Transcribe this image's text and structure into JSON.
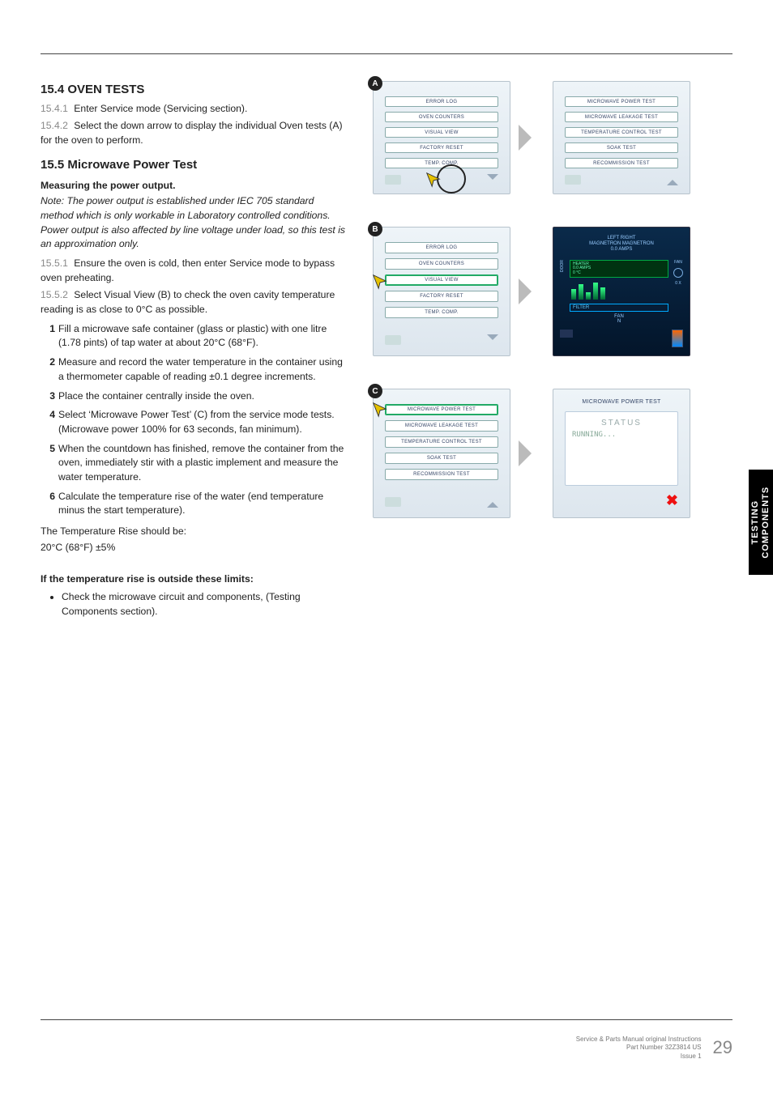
{
  "sidetab": "TESTING\nCOMPONENTS",
  "footer": {
    "line1": "Service & Parts Manual original Instructions",
    "line2": "Part Number 32Z3814 US",
    "line3": "Issue 1",
    "page": "29"
  },
  "s154": {
    "heading_num": "15.4",
    "heading": "OVEN TESTS",
    "p1_num": "15.4.1",
    "p1": "Enter Service mode (Servicing section).",
    "p2_num": "15.4.2",
    "p2": "Select the down arrow to display the individual Oven tests (A) for the oven to perform."
  },
  "s155": {
    "heading_num": "15.5",
    "heading": "Microwave Power Test",
    "sub_bold": "Measuring the power output.",
    "note": "Note: The power output is established under IEC 705 standard method which is only workable in Laboratory controlled conditions. Power output is also affected by line voltage under load, so this test is an approximation only.",
    "p1_num": "15.5.1",
    "p1": "Ensure the oven is cold, then enter Service mode to bypass oven preheating.",
    "p2_num": "15.5.2",
    "p2": "Select Visual View (B) to check the oven cavity temperature reading is as close to 0°C as possible.",
    "steps": [
      "Fill a microwave safe container (glass or plastic) with one litre (1.78 pints) of tap water at about 20°C (68°F).",
      "Measure and record the water temperature in the container using a thermometer capable of reading ±0.1 degree increments.",
      "Place the container centrally inside the oven.",
      "Select ‘Microwave Power Test’ (C) from the service mode tests. (Microwave power 100% for 63 seconds, fan minimum).",
      "When the countdown has finished, remove the container from the oven, immediately stir with a plastic implement and measure the water temperature.",
      "Calculate the temperature rise of the water (end temperature minus the start temperature)."
    ],
    "result_l1": "The Temperature Rise should be:",
    "result_l2": "20°C (68°F) ±5%",
    "outside_bold": "If the temperature rise is outside these limits:",
    "outside_bullet": "Check the microwave circuit and components, (Testing Components section)."
  },
  "figA": {
    "badge": "A",
    "left": [
      "ERROR LOG",
      "OVEN COUNTERS",
      "VISUAL VIEW",
      "FACTORY RESET",
      "TEMP. COMP."
    ],
    "right": [
      "MICROWAVE POWER TEST",
      "MICROWAVE LEAKAGE TEST",
      "TEMPERATURE CONTROL TEST",
      "SOAK TEST",
      "RECOMMISSION TEST"
    ]
  },
  "figB": {
    "badge": "B",
    "left": [
      "ERROR LOG",
      "OVEN COUNTERS",
      "VISUAL VIEW",
      "FACTORY RESET",
      "TEMP. COMP."
    ],
    "vv": {
      "hdr1": "LEFT        RIGHT",
      "hdr2": "MAGNETRON MAGNETRON",
      "hdr3": "0.0 AMPS",
      "heater1": "HEATER",
      "heater2": "0.0 AMPS",
      "heater3": "0 °C",
      "filter": "FILTER",
      "fan": "FAN",
      "fanN": "N",
      "door": "DOOR",
      "fanlabel": "FAN",
      "ax": "0 X"
    }
  },
  "figC": {
    "badge": "C",
    "left": [
      "MICROWAVE POWER TEST",
      "MICROWAVE LEAKAGE TEST",
      "TEMPERATURE CONTROL TEST",
      "SOAK TEST",
      "RECOMMISSION TEST"
    ],
    "right_title": "MICROWAVE POWER TEST",
    "status": "STATUS",
    "running": "RUNNING..."
  }
}
